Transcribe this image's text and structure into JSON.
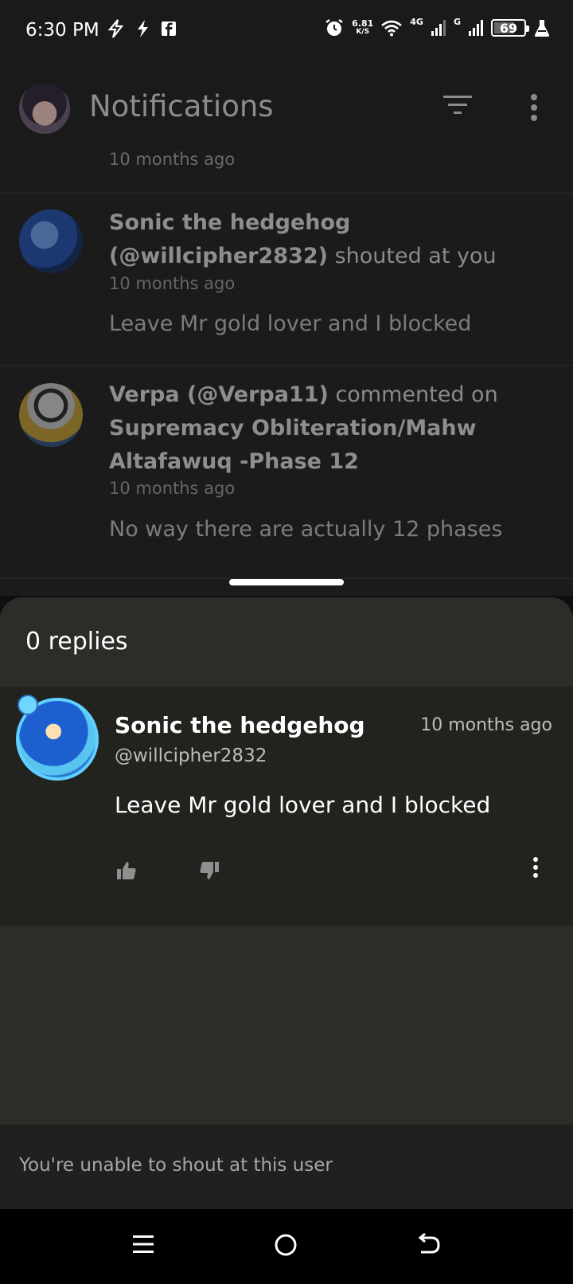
{
  "status_bar": {
    "time": "6:30 PM",
    "speed_value": "6.81",
    "speed_unit": "K/S",
    "net_1": "4G",
    "net_2": "G",
    "battery": "69",
    "battery_level": 0.69
  },
  "app_bar": {
    "title": "Notifications"
  },
  "notifications": {
    "top_time": "10 months ago",
    "items": [
      {
        "author": "Sonic the hedgehog",
        "handle": "(@willcipher2832)",
        "action": "shouted at you",
        "time": "10 months ago",
        "preview": "Leave Mr gold lover and I blocked"
      },
      {
        "author": "Verpa (@Verpa11)",
        "action": "commented on",
        "target": "Supremacy Obliteration/Mahw Altafawuq -Phase 12",
        "time": "10 months ago",
        "preview": "No way there are actually 12 phases"
      }
    ]
  },
  "sheet": {
    "replies": "0 replies",
    "comment": {
      "name": "Sonic the hedgehog",
      "handle": "@willcipher2832",
      "time": "10 months ago",
      "body": "Leave Mr gold lover and I blocked"
    },
    "shout_disabled": "You're unable to shout at this user"
  },
  "colors": {
    "background": "#1b1b1b",
    "sheet": "#2c2c29",
    "card": "#22221f"
  }
}
